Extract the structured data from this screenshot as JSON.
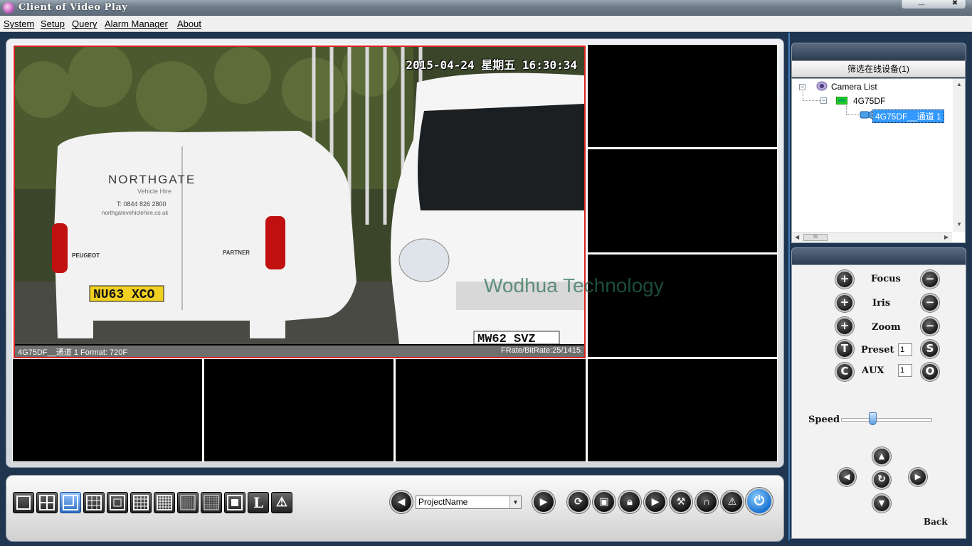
{
  "window": {
    "title": "Client of Video Play",
    "minimize": "—",
    "close": "✖"
  },
  "menu": [
    {
      "key": "S",
      "rest": "ystem"
    },
    {
      "key": "S",
      "rest": "etup"
    },
    {
      "key": "Q",
      "rest": "uery"
    },
    {
      "key": "A",
      "rest": "larm Manager"
    },
    {
      "key": "A",
      "rest": "bout"
    }
  ],
  "video": {
    "osd_time": "2015-04-24 星期五 16:30:34",
    "status_left": "4G75DF__通道 1 Format: 720F",
    "status_right": "FRate/BitRate:25/1415.",
    "watermark": "Wodhua Technology",
    "van_brand": "NORTHGATE",
    "van_sub": "Vehicle Hire",
    "van_phone": "T: 0844 826 2800",
    "van_web": "northgatevehiclehire.co.uk",
    "plate_left": "NU63 XCO",
    "plate_right": "MW62 SVZ",
    "peugeot": "PEUGEOT",
    "partner": "PARTNER"
  },
  "sidebar": {
    "filter_button": "筛选在线设备(1)",
    "tree": {
      "root": "Camera List",
      "device": "4G75DF",
      "channel": "4G75DF__通道 1"
    },
    "scroll_thumb": "III"
  },
  "ptz": {
    "focus": "Focus",
    "iris": "Iris",
    "zoom": "Zoom",
    "preset": "Preset",
    "aux": "AUX",
    "preset_value": "1",
    "aux_value": "1",
    "speed": "Speed",
    "speed_level": 0.35,
    "back": "Back",
    "btn_plus": "+",
    "btn_minus": "−",
    "btn_t": "T",
    "btn_s": "S",
    "btn_c": "C",
    "btn_o": "O"
  },
  "toolbar": {
    "project_select": "ProjectName",
    "prev_glyph": "◀",
    "next_glyph": "▶",
    "layout_l": "L",
    "layout_alarm": "⚠",
    "active_layout_index": 2
  },
  "colors": {
    "selection": "#3399ff",
    "alarm_border": "#dd2222",
    "accent_blue": "#1a72d0"
  }
}
